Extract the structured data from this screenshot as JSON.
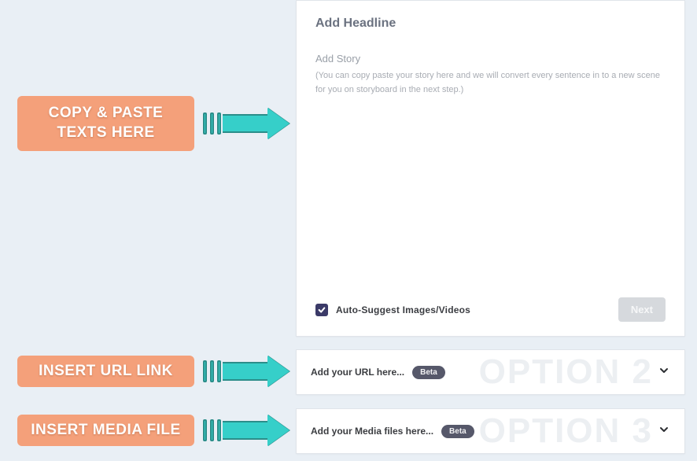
{
  "callouts": {
    "copy_paste": "COPY & PASTE TEXTS HERE",
    "insert_url": "INSERT URL LINK",
    "insert_media": "INSERT MEDIA FILE"
  },
  "story_panel": {
    "headline_placeholder": "Add Headline",
    "story_label": "Add Story",
    "story_hint": "(You can copy paste your story here and we will convert every sentence in to a new scene for you on storyboard in the next step.)",
    "auto_suggest_label": "Auto-Suggest Images/Videos",
    "auto_suggest_checked": true,
    "next_label": "Next"
  },
  "url_panel": {
    "title": "Add your URL here...",
    "badge": "Beta",
    "watermark": "OPTION 2"
  },
  "media_panel": {
    "title": "Add your Media files here...",
    "badge": "Beta",
    "watermark": "OPTION 3"
  }
}
